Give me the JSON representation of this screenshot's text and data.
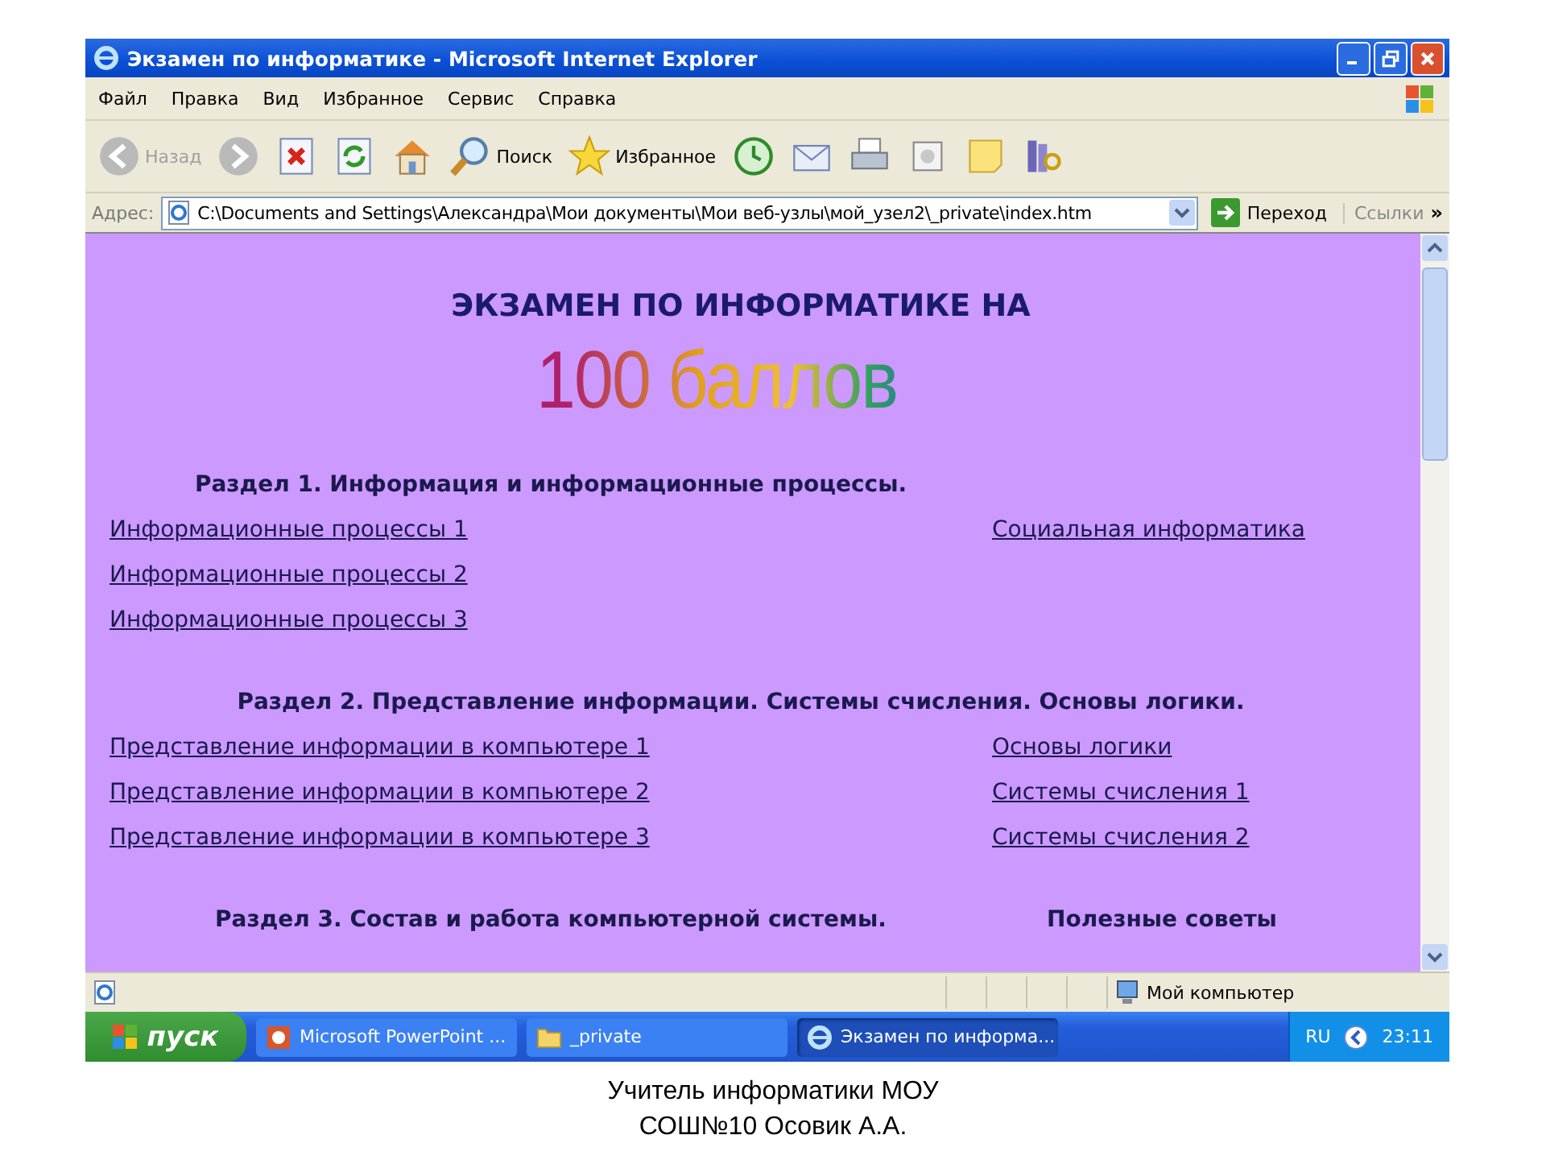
{
  "window": {
    "title": "Экзамен по информатике - Microsoft Internet Explorer"
  },
  "menu": [
    "Файл",
    "Правка",
    "Вид",
    "Избранное",
    "Сервис",
    "Справка"
  ],
  "toolbar": [
    {
      "kind": "back",
      "label": "Назад",
      "disabled": true
    },
    {
      "kind": "forward",
      "disabled": true
    },
    {
      "kind": "stop"
    },
    {
      "kind": "refresh"
    },
    {
      "kind": "home"
    },
    {
      "kind": "search",
      "label": "Поиск",
      "disabled": false
    },
    {
      "kind": "favorites",
      "label": "Избранное",
      "disabled": false
    },
    {
      "kind": "history"
    },
    {
      "kind": "mail"
    },
    {
      "kind": "print"
    },
    {
      "kind": "edit"
    },
    {
      "kind": "notes"
    },
    {
      "kind": "research"
    }
  ],
  "address": {
    "label": "Адрес:",
    "value": "C:\\Documents and Settings\\Александра\\Мои документы\\Мои веб-узлы\\мой_узел2\\_private\\index.htm",
    "go": "Переход",
    "links": "Ссылки",
    "more": "»"
  },
  "page": {
    "heading": "ЭКЗАМЕН ПО ИНФОРМАТИКЕ НА",
    "banner": "100 баллов",
    "sections": [
      {
        "kind": "column",
        "title": "Раздел 1. Информация и информационные процессы.",
        "left_links": [
          "Информационные процессы 1",
          "Информационные процессы 2",
          "Информационные процессы 3"
        ],
        "right_links": [
          "Социальная информатика"
        ]
      },
      {
        "kind": "wide",
        "title": "Раздел 2. Представление информации. Системы счисления. Основы логики.",
        "left_links": [
          "Представление информации в компьютере 1",
          "Представление информации в компьютере 2",
          "Представление информации в компьютере 3"
        ],
        "right_links": [
          "Основы логики",
          "Системы счисления 1",
          "Системы счисления 2"
        ]
      },
      {
        "kind": "column",
        "title": "Раздел 3. Состав и работа компьютерной системы.",
        "aside_title": "Полезные советы"
      }
    ]
  },
  "status_bar": {
    "zone": "Мой компьютер"
  },
  "taskbar": {
    "start": "пуск",
    "tasks": [
      {
        "kind": "powerpoint",
        "label": "Microsoft PowerPoint ...",
        "selected": false
      },
      {
        "kind": "folder",
        "label": "_private",
        "selected": false
      },
      {
        "kind": "browser",
        "label": "Экзамен по информа...",
        "selected": true
      }
    ],
    "language": "RU",
    "clock": "23:11"
  },
  "caption": [
    "Учитель информатики МОУ",
    "СОШ№10 Осовик А.А."
  ]
}
